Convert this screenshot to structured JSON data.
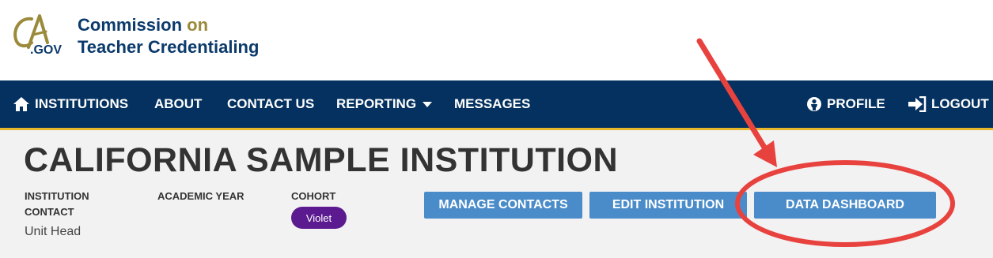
{
  "header": {
    "logo_text": "CA.GOV",
    "org_line1_a": "Commission ",
    "org_line1_b": "on",
    "org_line2": "Teacher Credentialing"
  },
  "nav": {
    "institutions": "INSTITUTIONS",
    "about": "ABOUT",
    "contact_us": "CONTACT US",
    "reporting": "REPORTING",
    "messages": "MESSAGES",
    "profile": "PROFILE",
    "logout": "LOGOUT"
  },
  "institution": {
    "name": "CALIFORNIA SAMPLE INSTITUTION",
    "contact_label": "INSTITUTION CONTACT",
    "contact_value": "Unit Head",
    "academic_year_label": "ACADEMIC YEAR",
    "cohort_label": "COHORT",
    "cohort_value": "Violet"
  },
  "actions": {
    "manage_contacts": "MANAGE CONTACTS",
    "edit_institution": "EDIT INSTITUTION",
    "data_dashboard": "DATA DASHBOARD"
  },
  "colors": {
    "navbar": "#04315f",
    "nav_underline": "#e8b62a",
    "button": "#4a8cc9",
    "cohort_badge": "#5b1a8f",
    "annotation": "#e8423f",
    "brand_blue": "#0b3a6b",
    "brand_gold": "#9a8a3a"
  }
}
